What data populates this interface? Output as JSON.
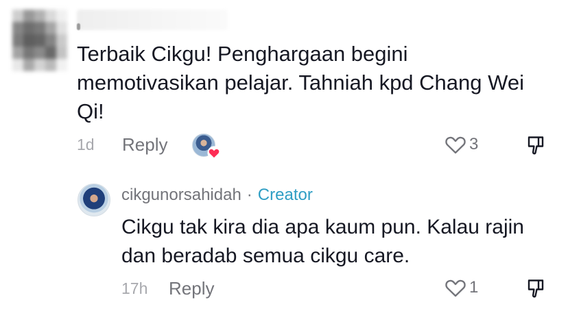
{
  "comments": [
    {
      "username": "",
      "text": "Terbaik Cikgu! Penghargaan begini memotivasikan pelajar. Tahniah kpd Chang Wei Qi!",
      "time": "1d",
      "reply_label": "Reply",
      "likes": "3",
      "liked_by_creator": true
    },
    {
      "username": "cikgunorsahidah",
      "separator": "·",
      "role_badge": "Creator",
      "text": "Cikgu tak kira dia apa kaum pun. Kalau rajin dan beradab semua cikgu care.",
      "time": "17h",
      "reply_label": "Reply",
      "likes": "1"
    }
  ],
  "colors": {
    "text": "#161823",
    "muted": "#73747a",
    "time": "#a7a8ad",
    "creator_badge": "#2f9ec4",
    "heart": "#fe2c55"
  },
  "icons": [
    "heart-outline-icon",
    "dislike-icon",
    "heart-filled-icon"
  ]
}
